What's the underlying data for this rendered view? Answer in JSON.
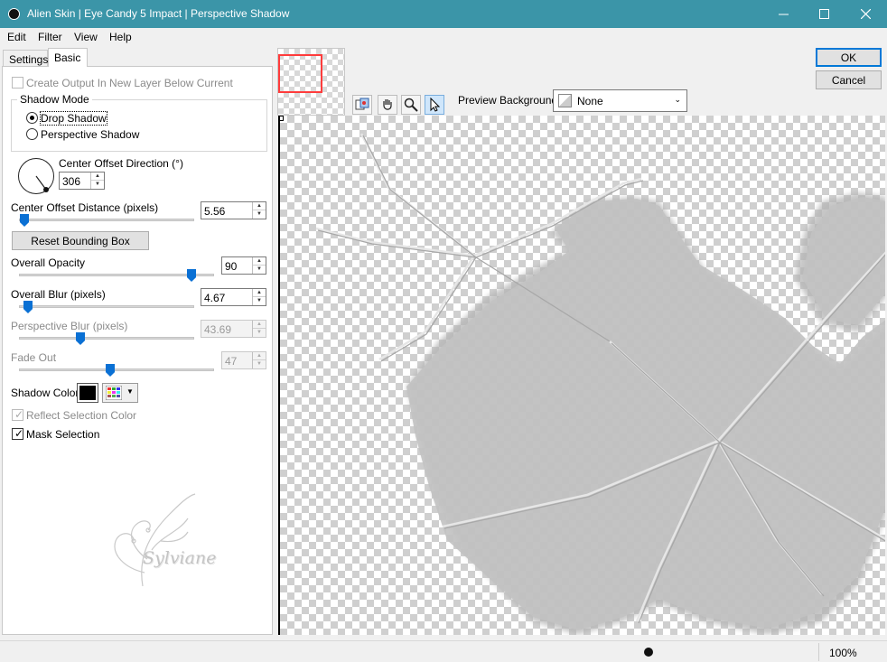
{
  "window": {
    "title": "Alien Skin | Eye Candy 5 Impact | Perspective Shadow"
  },
  "menu": {
    "items": [
      "Edit",
      "Filter",
      "View",
      "Help"
    ]
  },
  "tabs": [
    "Settings",
    "Basic"
  ],
  "basic": {
    "create_output": {
      "label": "Create Output In New Layer Below Current",
      "checked": false,
      "enabled": false
    },
    "shadow_mode": {
      "title": "Shadow Mode",
      "options": [
        "Drop Shadow",
        "Perspective Shadow"
      ],
      "selected": "Drop Shadow"
    },
    "direction": {
      "label": "Center Offset Direction (°)",
      "value": "306"
    },
    "offset_distance": {
      "label": "Center Offset Distance (pixels)",
      "value": "5.56",
      "slider_fraction": 0.05
    },
    "reset_button": "Reset Bounding Box",
    "overall_opacity": {
      "label": "Overall Opacity",
      "value": "90",
      "slider_fraction": 0.9
    },
    "overall_blur": {
      "label": "Overall Blur (pixels)",
      "value": "4.67",
      "slider_fraction": 0.05
    },
    "perspective_blur": {
      "label": "Perspective Blur (pixels)",
      "value": "43.69",
      "slider_fraction": 0.35,
      "enabled": false
    },
    "fade_out": {
      "label": "Fade Out",
      "value": "47",
      "slider_fraction": 0.47,
      "enabled": false
    },
    "shadow_color": {
      "label": "Shadow Color",
      "color": "#000000"
    },
    "reflect_selection": {
      "label": "Reflect Selection Color",
      "checked": true,
      "enabled": false
    },
    "mask_selection": {
      "label": "Mask Selection",
      "checked": true
    }
  },
  "watermark": {
    "text": "Sylviane"
  },
  "preview": {
    "background_label": "Preview Background:",
    "background_value": "None"
  },
  "buttons": {
    "ok": "OK",
    "cancel": "Cancel"
  },
  "status": {
    "zoom": "100%"
  },
  "colors": {
    "titlebar": "#3b95a8",
    "slider": "#0a70d4",
    "default_button": "#0078d7"
  }
}
